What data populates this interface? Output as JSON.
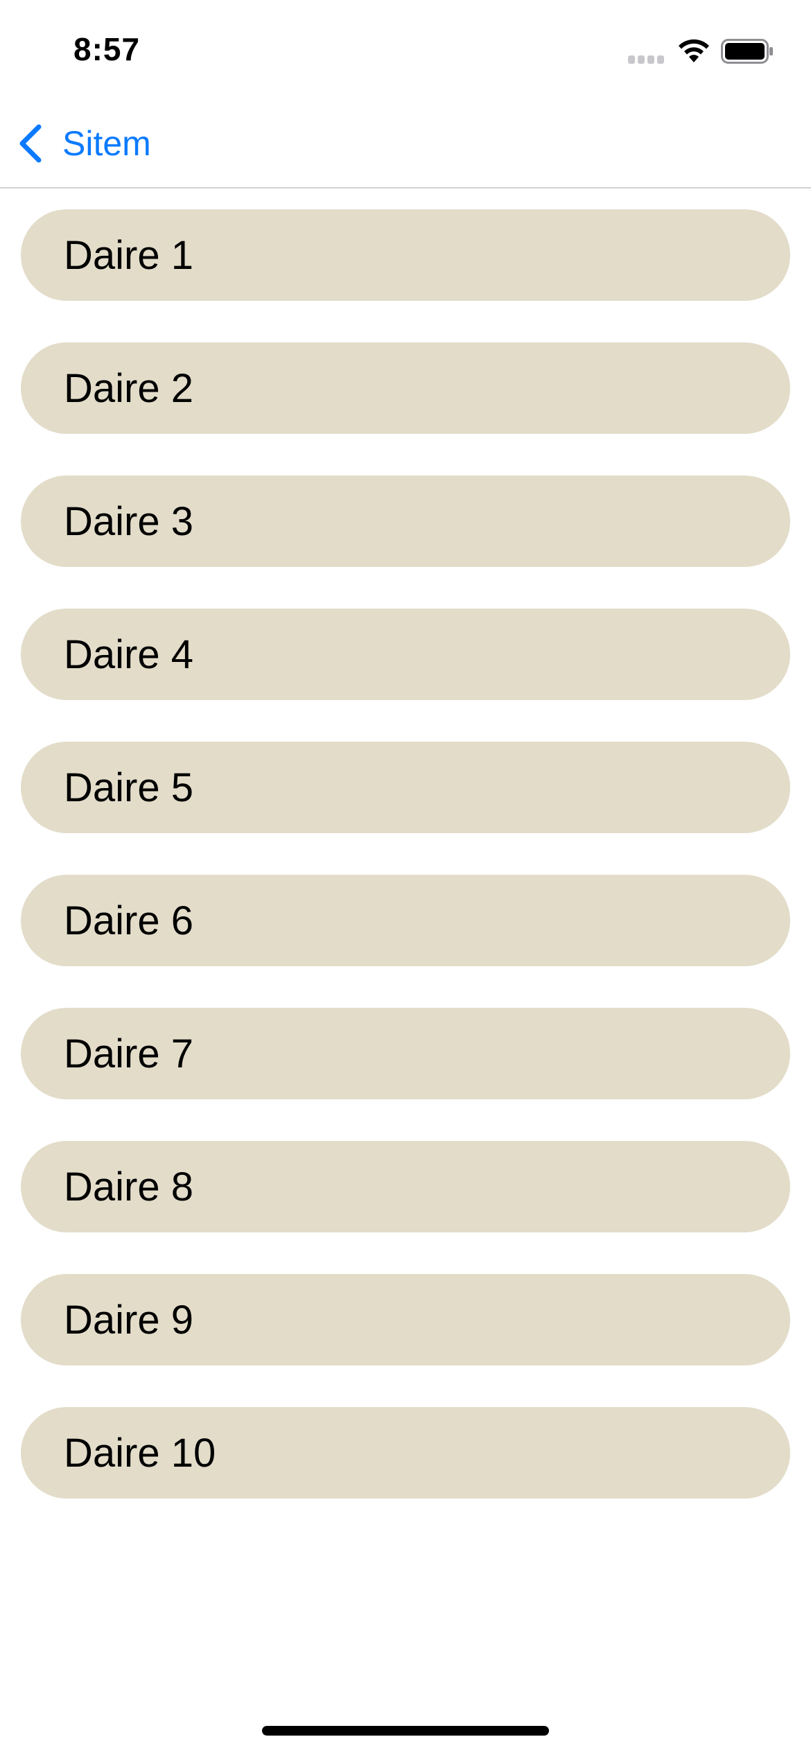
{
  "status_bar": {
    "time": "8:57",
    "signal_icon": "cellular-signal-icon",
    "wifi_icon": "wifi-icon",
    "battery_icon": "battery-icon"
  },
  "nav": {
    "back_icon": "chevron-left-icon",
    "back_label": "Sitem",
    "accent_color": "#0a7aff"
  },
  "list": {
    "row_color": "#e2dcc9",
    "items": [
      {
        "label": "Daire 1"
      },
      {
        "label": "Daire 2"
      },
      {
        "label": "Daire 3"
      },
      {
        "label": "Daire 4"
      },
      {
        "label": "Daire 5"
      },
      {
        "label": "Daire 6"
      },
      {
        "label": "Daire 7"
      },
      {
        "label": "Daire 8"
      },
      {
        "label": "Daire 9"
      },
      {
        "label": "Daire 10"
      }
    ]
  }
}
